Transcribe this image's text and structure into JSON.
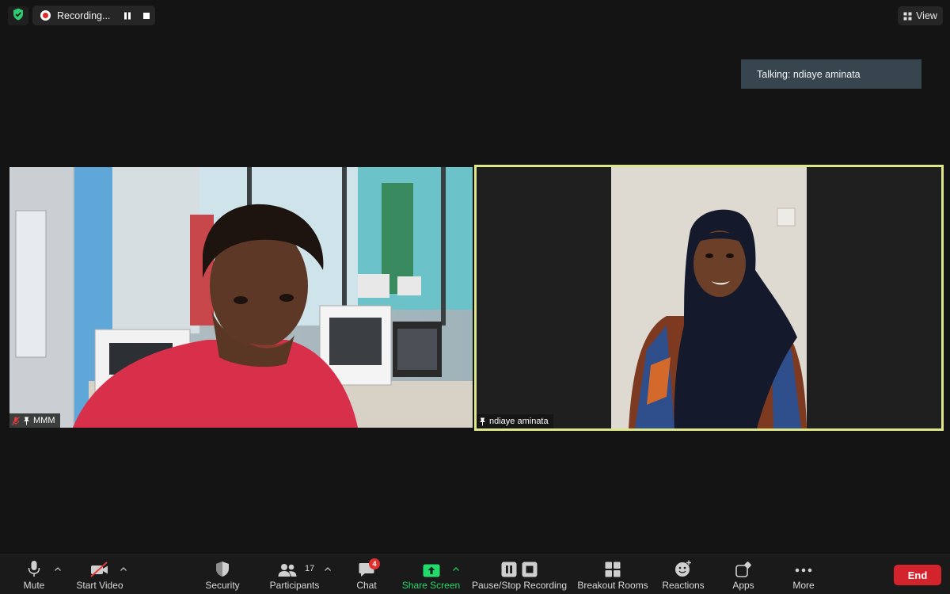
{
  "recording": {
    "label": "Recording..."
  },
  "view_button": {
    "label": "View"
  },
  "talking_indicator": {
    "text": "Talking: ndiaye aminata"
  },
  "participants": [
    {
      "name": "MMM",
      "muted": true,
      "pinned": true
    },
    {
      "name": "ndiaye aminata",
      "muted": false,
      "pinned": true,
      "active_speaker": true
    }
  ],
  "toolbar": {
    "mute": "Mute",
    "start_video": "Start Video",
    "security": "Security",
    "participants": "Participants",
    "participants_count": "17",
    "chat": "Chat",
    "chat_badge": "4",
    "share_screen": "Share Screen",
    "pause_stop_recording": "Pause/Stop Recording",
    "breakout_rooms": "Breakout Rooms",
    "reactions": "Reactions",
    "apps": "Apps",
    "more": "More",
    "end": "End"
  },
  "colors": {
    "background": "#141414",
    "active_speaker_border": "#dde68a",
    "share_green": "#23d96b",
    "end_red": "#d3232c",
    "recording_red": "#e02828",
    "shield_green": "#2ecc71"
  }
}
